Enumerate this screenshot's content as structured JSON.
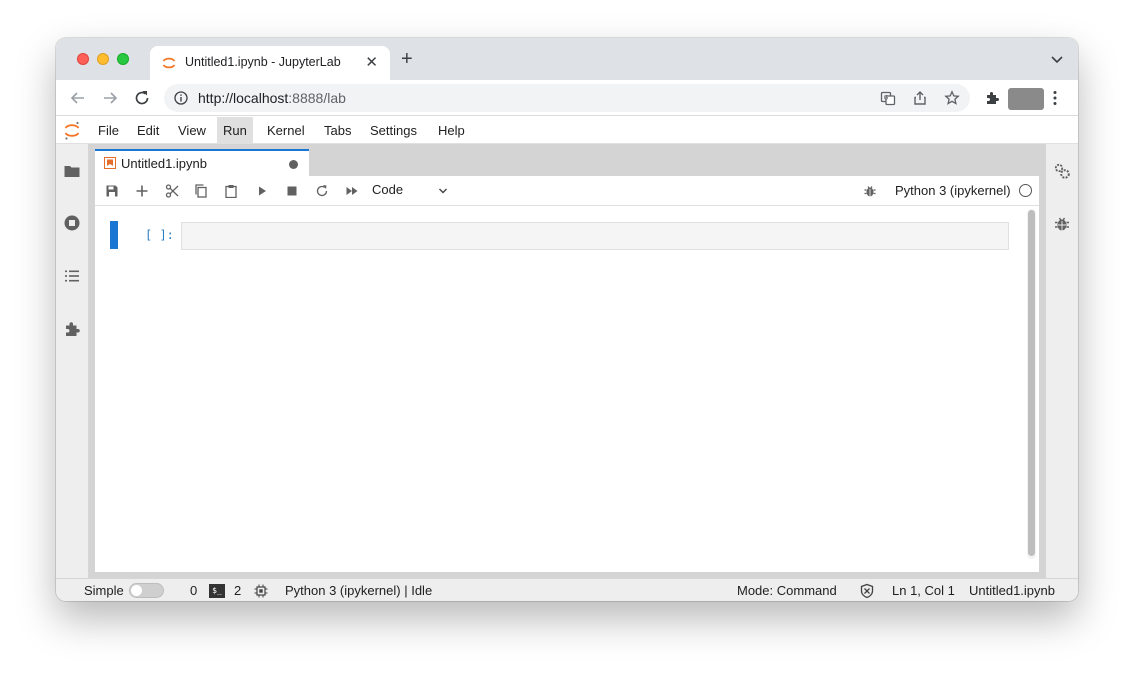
{
  "browser": {
    "tab_title": "Untitled1.ipynb - JupyterLab",
    "tab_close": "✕",
    "new_tab": "+",
    "url_scheme_host": "http://localhost",
    "url_rest": ":8888/lab"
  },
  "menubar": {
    "items": [
      "File",
      "Edit",
      "View",
      "Run",
      "Kernel",
      "Tabs",
      "Settings",
      "Help"
    ],
    "active": "Run"
  },
  "document": {
    "tab_title": "Untitled1.ipynb",
    "cell_type": "Code",
    "kernel_name": "Python 3 (ipykernel)",
    "prompt": "[ ]:"
  },
  "statusbar": {
    "mode_label": "Simple",
    "terminals_count": "0",
    "kernels_count": "2",
    "kernel_status": "Python 3 (ipykernel) | Idle",
    "mode": "Mode: Command",
    "cursor": "Ln 1, Col 1",
    "filename": "Untitled1.ipynb"
  },
  "colors": {
    "accent": "#1976d2",
    "jupyter_orange": "#f37726",
    "active_menu_bg": "#e0e0e0"
  }
}
